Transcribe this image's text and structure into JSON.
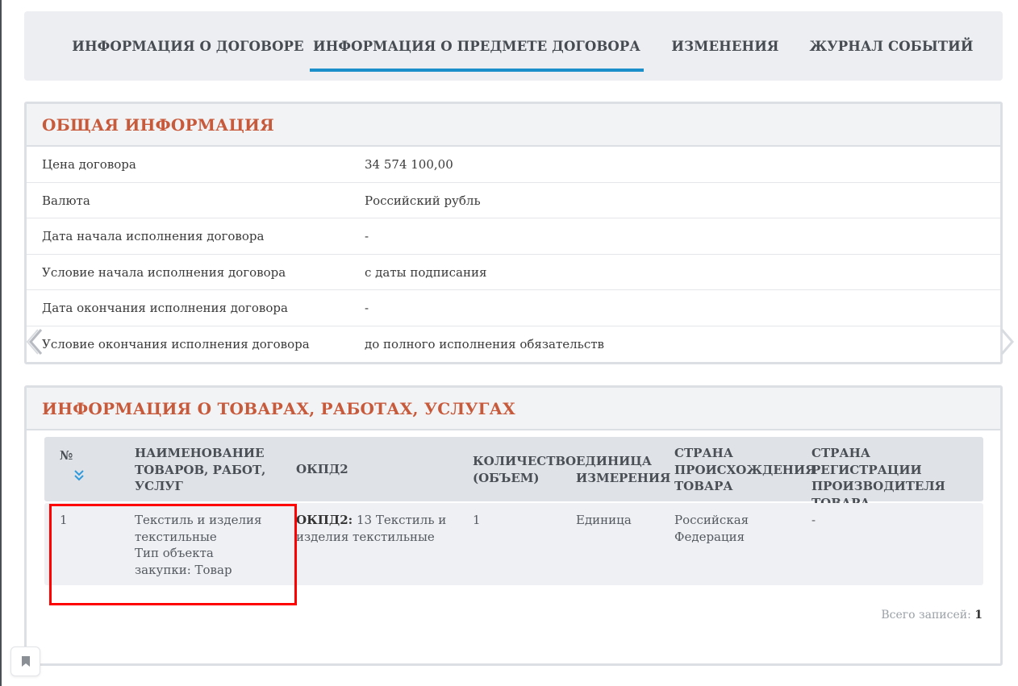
{
  "tabs": [
    {
      "label": "ИНФОРМАЦИЯ О ДОГОВОРЕ",
      "active": false
    },
    {
      "label": "ИНФОРМАЦИЯ О ПРЕДМЕТЕ ДОГОВОРА",
      "active": true
    },
    {
      "label": "ИЗМЕНЕНИЯ",
      "active": false
    },
    {
      "label": "ЖУРНАЛ СОБЫТИЙ",
      "active": false
    }
  ],
  "general": {
    "title": "ОБЩАЯ ИНФОРМАЦИЯ",
    "rows": [
      {
        "label": "Цена договора",
        "value": "34 574 100,00"
      },
      {
        "label": "Валюта",
        "value": "Российский рубль"
      },
      {
        "label": "Дата начала исполнения договора",
        "value": "-"
      },
      {
        "label": "Условие начала исполнения договора",
        "value": "с даты подписания"
      },
      {
        "label": "Дата окончания исполнения договора",
        "value": "-"
      },
      {
        "label": "Условие окончания исполнения договора",
        "value": "до полного исполнения обязательств"
      }
    ]
  },
  "products": {
    "title": "ИНФОРМАЦИЯ О ТОВАРАХ, РАБОТАХ, УСЛУГАХ",
    "columns": {
      "num": "№",
      "name": [
        "НАИМЕНОВАНИЕ",
        "ТОВАРОВ, РАБОТ,",
        "УСЛУГ"
      ],
      "okpd": "ОКПД2",
      "qty": [
        "КОЛИЧЕСТВО",
        "(ОБЪЕМ)"
      ],
      "unit": [
        "ЕДИНИЦА",
        "ИЗМЕРЕНИЯ"
      ],
      "origin": [
        "СТРАНА",
        "ПРОИСХОЖДЕНИЯ",
        "ТОВАРА"
      ],
      "reg": [
        "СТРАНА РЕГИСТРАЦИИ",
        "ПРОИЗВОДИТЕЛЯ",
        "ТОВАРА"
      ]
    },
    "row": {
      "num": "1",
      "name": [
        "Текстиль и изделия",
        "текстильные",
        "Тип объекта",
        "закупки: Товар"
      ],
      "okpd_label": "ОКПД2:",
      "okpd_value": [
        "13 Текстиль и",
        "изделия текстильные"
      ],
      "qty": "1",
      "unit": "Единица",
      "origin": [
        "Российская",
        "Федерация"
      ],
      "reg": "-"
    },
    "total_label": "Всего записей:",
    "total_value": "1"
  },
  "colors": {
    "accent": "#1b8fc9",
    "heading": "#c85a3c",
    "highlight": "#ff0000"
  },
  "icons": [
    "chevron-down-double-icon",
    "chevron-left-icon",
    "chevron-right-icon",
    "bookmark-icon"
  ]
}
